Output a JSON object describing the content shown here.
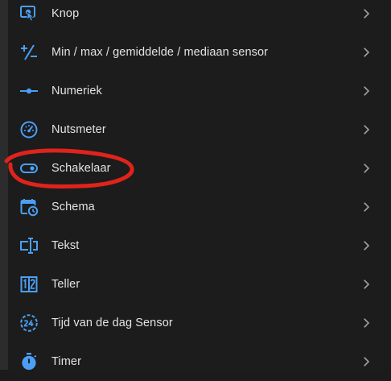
{
  "colors": {
    "icon_blue": "#4a9ff5",
    "text": "#e3e3e3",
    "chevron": "#9e9e9e",
    "background": "#1c1c1c",
    "annotation_red": "#e0231b"
  },
  "items": [
    {
      "label": "Knop",
      "icon": "button-press-icon"
    },
    {
      "label": "Min / max / gemiddelde / mediaan sensor",
      "icon": "plus-minus-icon"
    },
    {
      "label": "Numeriek",
      "icon": "ray-vertex-icon"
    },
    {
      "label": "Nutsmeter",
      "icon": "gauge-icon"
    },
    {
      "label": "Schakelaar",
      "icon": "toggle-switch-icon"
    },
    {
      "label": "Schema",
      "icon": "calendar-clock-icon"
    },
    {
      "label": "Tekst",
      "icon": "form-textbox-icon"
    },
    {
      "label": "Teller",
      "icon": "counter-icon"
    },
    {
      "label": "Tijd van de dag Sensor",
      "icon": "hours-24-icon"
    },
    {
      "label": "Timer",
      "icon": "timer-icon"
    }
  ],
  "annotation": {
    "type": "hand-drawn-ellipse",
    "target": "Schakelaar",
    "color": "#e0231b"
  }
}
